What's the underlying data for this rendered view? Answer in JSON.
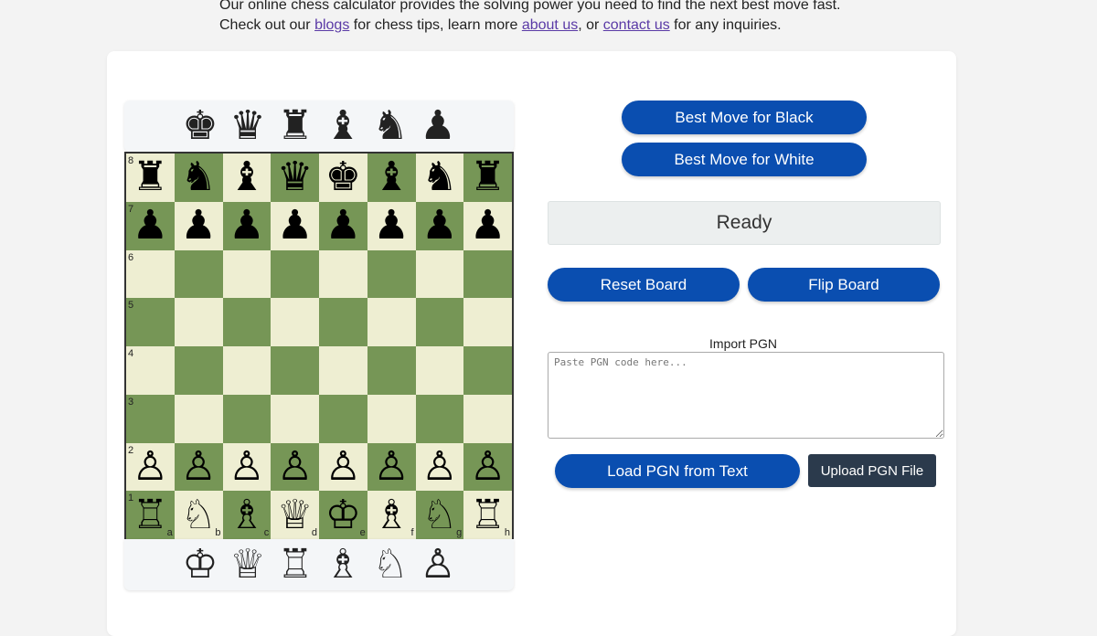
{
  "intro": {
    "line1": "Our online chess calculator provides the solving power you need to find the next best move fast.",
    "line2_before": "Check out our ",
    "link_blogs": "blogs",
    "line2_mid1": " for chess tips, learn more ",
    "link_about": "about us",
    "line2_mid2": ", or ",
    "link_contact": "contact us",
    "line2_after": " for any inquiries."
  },
  "spare_pieces": {
    "black": [
      "♚",
      "♛",
      "♜",
      "♝",
      "♞",
      "♟"
    ],
    "white": [
      "♔",
      "♕",
      "♖",
      "♗",
      "♘",
      "♙"
    ]
  },
  "board": {
    "ranks": [
      "8",
      "7",
      "6",
      "5",
      "4",
      "3",
      "2",
      "1"
    ],
    "files": [
      "a",
      "b",
      "c",
      "d",
      "e",
      "f",
      "g",
      "h"
    ],
    "light_color": "#eeeed2",
    "dark_color": "#769656",
    "position": [
      [
        "♜",
        "♞",
        "♝",
        "♛",
        "♚",
        "♝",
        "♞",
        "♜"
      ],
      [
        "♟",
        "♟",
        "♟",
        "♟",
        "♟",
        "♟",
        "♟",
        "♟"
      ],
      [
        "",
        "",
        "",
        "",
        "",
        "",
        "",
        ""
      ],
      [
        "",
        "",
        "",
        "",
        "",
        "",
        "",
        ""
      ],
      [
        "",
        "",
        "",
        "",
        "",
        "",
        "",
        ""
      ],
      [
        "",
        "",
        "",
        "",
        "",
        "",
        "",
        ""
      ],
      [
        "♙",
        "♙",
        "♙",
        "♙",
        "♙",
        "♙",
        "♙",
        "♙"
      ],
      [
        "♖",
        "♘",
        "♗",
        "♕",
        "♔",
        "♗",
        "♘",
        "♖"
      ]
    ]
  },
  "controls": {
    "best_black": "Best Move for Black",
    "best_white": "Best Move for White",
    "status": "Ready",
    "reset": "Reset Board",
    "flip": "Flip Board",
    "pgn_label": "Import PGN",
    "pgn_placeholder": "Paste PGN code here...",
    "load_pgn": "Load PGN from Text",
    "upload_pgn": "Upload PGN File"
  },
  "colors": {
    "primary_button": "#0a4eb0",
    "dark_button": "#2b3a4c",
    "link": "#5a3aa6"
  }
}
